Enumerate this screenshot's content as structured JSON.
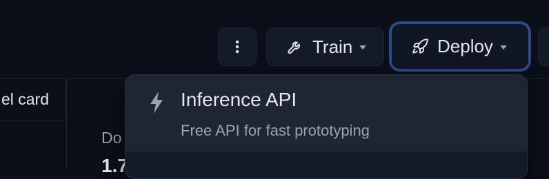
{
  "header": {
    "more_icon": "vertical-dots-icon",
    "train": {
      "label": "Train",
      "icon": "wrench-icon"
    },
    "deploy": {
      "label": "Deploy",
      "icon": "rocket-icon"
    }
  },
  "content": {
    "tab_label": "el card",
    "stat_label": "Do",
    "stat_value": "1.7"
  },
  "deploy_menu": {
    "items": [
      {
        "title": "Inference API",
        "description": "Free API for fast prototyping",
        "icon": "lightning-icon"
      }
    ]
  },
  "colors": {
    "background": "#0b0f19",
    "button_bg": "#141a27",
    "focus_ring": "#2c4a83",
    "menu_bg": "#1f2533",
    "muted_text": "#9ca3af"
  }
}
